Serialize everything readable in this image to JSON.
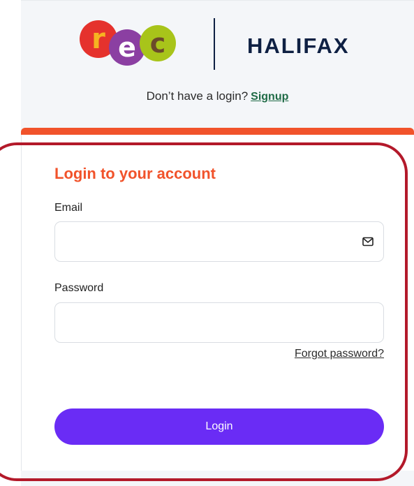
{
  "brand": {
    "rec_letters": [
      "r",
      "e",
      "c"
    ],
    "partner_name": "HALIFAX",
    "colors": {
      "rec_red": "#e5322d",
      "rec_purple": "#8b3fa2",
      "rec_green": "#a8c41a",
      "halifax_navy": "#0e2043"
    }
  },
  "signup": {
    "prompt": "Don’t have a login?",
    "link_label": "Signup"
  },
  "login_form": {
    "title": "Login to your account",
    "email_label": "Email",
    "email_value": "",
    "email_icon": "envelope-icon",
    "password_label": "Password",
    "password_value": "",
    "forgot_label": "Forgot password?",
    "submit_label": "Login"
  },
  "colors": {
    "accent_orange": "#f1532b",
    "button_purple": "#6a2cf5",
    "highlight_red": "#b3192a",
    "signup_green": "#1f6b46"
  }
}
